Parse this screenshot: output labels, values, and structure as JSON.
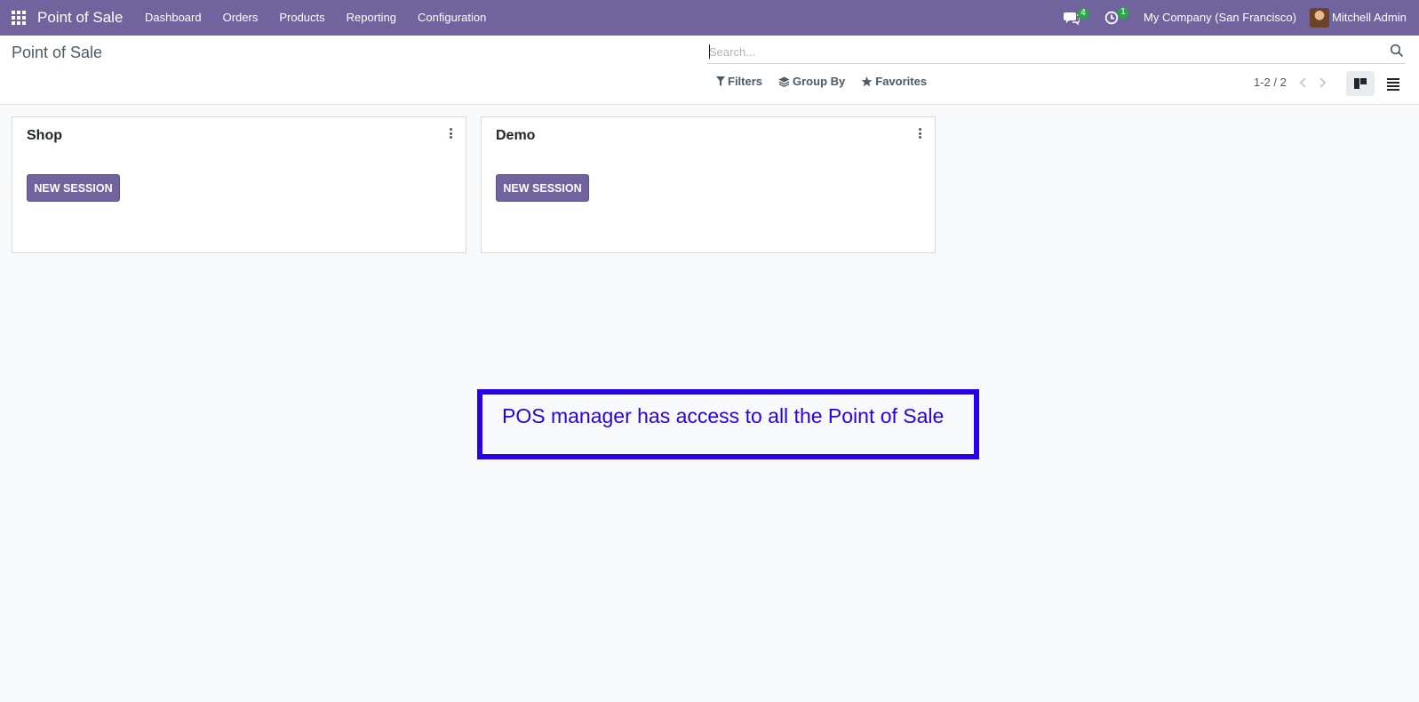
{
  "navbar": {
    "brand": "Point of Sale",
    "menu": [
      "Dashboard",
      "Orders",
      "Products",
      "Reporting",
      "Configuration"
    ],
    "messages_badge": "4",
    "activities_badge": "1",
    "company": "My Company (San Francisco)",
    "user": "Mitchell Admin"
  },
  "control_panel": {
    "breadcrumb": "Point of Sale",
    "search_placeholder": "Search...",
    "filters_label": "Filters",
    "group_by_label": "Group By",
    "favorites_label": "Favorites",
    "pager": "1-2 / 2"
  },
  "cards": [
    {
      "title": "Shop",
      "button": "NEW SESSION"
    },
    {
      "title": "Demo",
      "button": "NEW SESSION"
    }
  ],
  "annotation": {
    "text": "POS manager has access to all the Point of Sale",
    "color": "#2a00e6"
  },
  "colors": {
    "brand": "#71639e",
    "badge": "#28a745",
    "background": "#f8f9fa"
  }
}
